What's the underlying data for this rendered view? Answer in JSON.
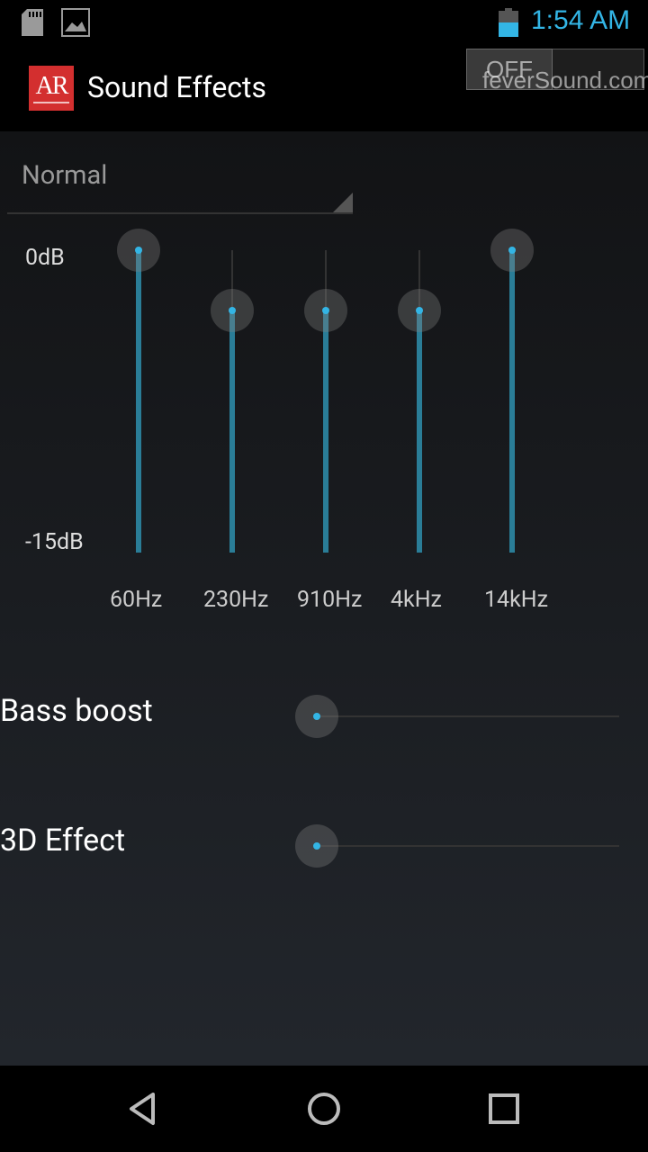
{
  "status_bar": {
    "time": "1:54 AM",
    "icons": [
      "sd-card-icon",
      "gallery-icon",
      "battery-icon"
    ],
    "accent_color": "#33b5e5"
  },
  "action_bar": {
    "app_logo_text": "AR",
    "title": "Sound Effects",
    "toggle_label": "OFF",
    "watermark": "feverSound.com"
  },
  "equalizer": {
    "preset": "Normal",
    "db_max": "0dB",
    "db_min": "-15dB",
    "bands": [
      {
        "label": "60Hz",
        "level": 1.0
      },
      {
        "label": "230Hz",
        "level": 0.8
      },
      {
        "label": "910Hz",
        "level": 0.8
      },
      {
        "label": "4kHz",
        "level": 0.8
      },
      {
        "label": "14kHz",
        "level": 1.0
      }
    ]
  },
  "effects": {
    "bass_boost_label": "Bass boost",
    "bass_boost_value": 0,
    "effect_3d_label": "3D Effect",
    "effect_3d_value": 0
  },
  "nav_bar": {
    "icons": [
      "back-icon",
      "home-icon",
      "recent-apps-icon"
    ]
  }
}
